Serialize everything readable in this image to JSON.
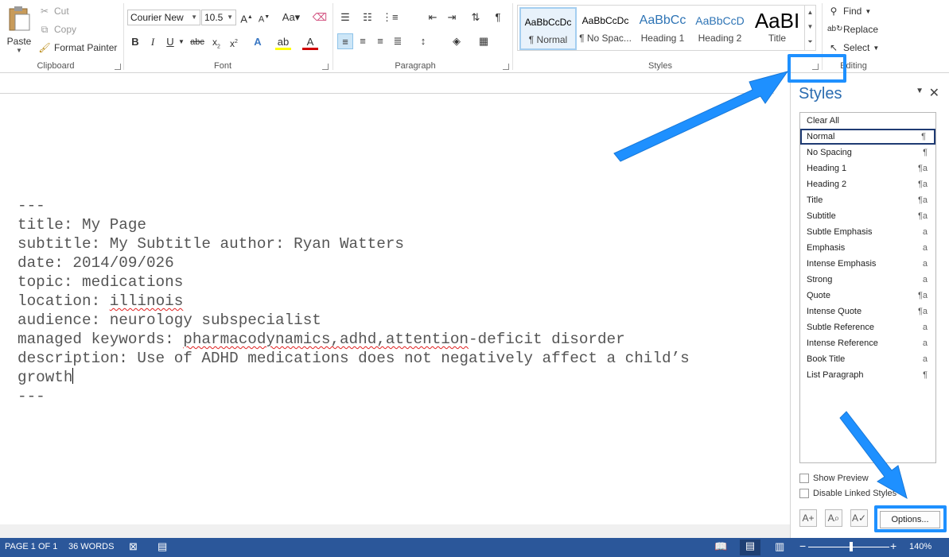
{
  "ribbon": {
    "clipboard": {
      "paste_label": "Paste",
      "cut_label": "Cut",
      "copy_label": "Copy",
      "format_painter_label": "Format Painter",
      "group_label": "Clipboard"
    },
    "font": {
      "font_name": "Courier New",
      "font_size": "10.5",
      "group_label": "Font"
    },
    "paragraph": {
      "group_label": "Paragraph"
    },
    "styles": {
      "group_label": "Styles",
      "tiles": [
        {
          "sample": "AaBbCcDc",
          "name": "¶ Normal"
        },
        {
          "sample": "AaBbCcDc",
          "name": "¶ No Spac..."
        },
        {
          "sample": "AaBbCc",
          "name": "Heading 1"
        },
        {
          "sample": "AaBbCcD",
          "name": "Heading 2"
        },
        {
          "sample": "AaBI",
          "name": "Title"
        }
      ]
    },
    "editing": {
      "find_label": "Find",
      "replace_label": "Replace",
      "select_label": "Select",
      "group_label": "Editing"
    }
  },
  "document": {
    "lines": [
      "---",
      "title: My Page",
      "subtitle: My Subtitle author: Ryan Watters",
      "date: 2014/09/026",
      "topic: medications",
      "location: ",
      "audience: neurology subspecialist",
      "managed keywords: ",
      "description: Use of ADHD medications does not negatively affect a child’s",
      "growth",
      "---"
    ],
    "location_value": "illinois",
    "keywords_misspelled": "pharmacodynamics,adhd,attention",
    "keywords_rest": "-deficit disorder"
  },
  "styles_pane": {
    "title": "Styles",
    "items": [
      {
        "label": "Clear All",
        "mark": ""
      },
      {
        "label": "Normal",
        "mark": "¶"
      },
      {
        "label": "No Spacing",
        "mark": "¶"
      },
      {
        "label": "Heading 1",
        "mark": "¶a"
      },
      {
        "label": "Heading 2",
        "mark": "¶a"
      },
      {
        "label": "Title",
        "mark": "¶a"
      },
      {
        "label": "Subtitle",
        "mark": "¶a"
      },
      {
        "label": "Subtle Emphasis",
        "mark": "a"
      },
      {
        "label": "Emphasis",
        "mark": "a"
      },
      {
        "label": "Intense Emphasis",
        "mark": "a"
      },
      {
        "label": "Strong",
        "mark": "a"
      },
      {
        "label": "Quote",
        "mark": "¶a"
      },
      {
        "label": "Intense Quote",
        "mark": "¶a"
      },
      {
        "label": "Subtle Reference",
        "mark": "a"
      },
      {
        "label": "Intense Reference",
        "mark": "a"
      },
      {
        "label": "Book Title",
        "mark": "a"
      },
      {
        "label": "List Paragraph",
        "mark": "¶"
      }
    ],
    "show_preview_label": "Show Preview",
    "disable_linked_label": "Disable Linked Styles",
    "options_label": "Options..."
  },
  "status_bar": {
    "page": "PAGE 1 OF 1",
    "words": "36 WORDS",
    "zoom": "140%"
  },
  "colors": {
    "accent": "#2b579a",
    "callout": "#1e90ff",
    "pane_title": "#2b6cb0"
  }
}
